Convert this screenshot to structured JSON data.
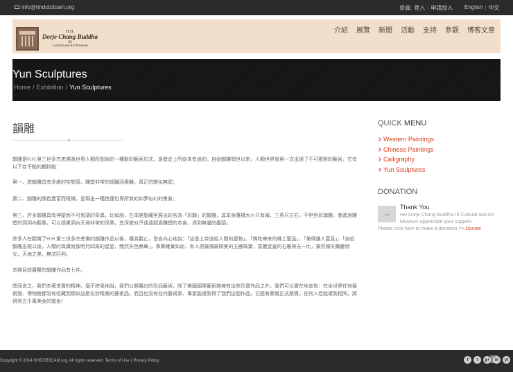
{
  "topbar": {
    "email": "info@hhdcb3cam.org",
    "member_label": "會員:",
    "login": "登入",
    "join": "申請加入",
    "lang_en": "English",
    "lang_zh": "中文"
  },
  "logo": {
    "line1": "H.H.",
    "line2": "Dorje Chang Buddha",
    "line3": "III",
    "line4": "Cultural and Art Museum"
  },
  "nav": {
    "items": [
      "介紹",
      "展覽",
      "新聞",
      "活動",
      "支持",
      "參觀",
      "博客文章"
    ]
  },
  "banner": {
    "title": "Yun Sculptures",
    "breadcrumb": [
      "Home",
      "Exhibition",
      "Yun Sculptures"
    ],
    "separator": "/"
  },
  "article": {
    "heading": "韻雕",
    "paragraphs": [
      "韻雕是H.H.第三世多杰羌佛為世界人類所創始的一種新的藝術形式，是歷史上所從未有過的。自從韻雕問世以來，人類世界就第一次出現了不可複製的藝術，它有以下若干點的獨特點：",
      "第一、造韻雕具有多維的空間感，雕塑非常的細膩而複雜，真正的變化無窮；",
      "第二、韻雕的顏色豐富而斑斕，呈現出一種造僅世界所無的如夢似幻的景象；",
      "第三、許多韻雕具有神聖而不可思議的奇異，比如說，在本館聖藏室展出的名為「彩韻」的韻雕，其本身雕構大小只有兩、三英尺左右，不但色彩瑰麗，會進過雕塑的洞洞內觀看，可以感覺洞內天地非常的深奧，其深度似乎遠遠超過雕塑的本身，達到無邊的盡頭。",
      "許多人在觀賞了H.H.第三世多杰羌佛的韻雕作品以後，嘆為觀止，發自內心地說：「這是上帝送給人間的寶物」、「佛陀帶來的佛土聖品」、「美得讓人窒息」、「自從韻雕出現以後，人類的珠寶就像明月四周的星星，黯然失色無華」，事實確實如此，有人把最傳最精美的玉器珠寶，富麗堂皇的石雕帶去一比，果然頓失豔麗特光，天地之差，無法匹判。",
      "本館目前展覽的韻雕作品有七件。",
      "總而言之，我們本著求實的精神，毫不誇張地說，我們公開展出的珍品藝術，除了美國國際藝術館擁有這些珍寶作品之外，我們可以實在地宣告：在全世界任何藝術館、博物館都沒有收藏到類似這麼玄妙精美的藝術品，而且也沒有任何藝術家、專家能複製得了我們這個作品，已經有懸賞正式懸賞，任何人若能複製相同，將得到五千萬美金的獎金！"
    ]
  },
  "sidebar": {
    "quick_prefix": "QUICK",
    "quick_suffix": "MENU",
    "menu": [
      "Western Paintings",
      "Chinese Paintings",
      "Calligraphy",
      "Yun Sculptures"
    ]
  },
  "donation": {
    "heading": "DONATION",
    "thumb_label": "img",
    "title": "Thank You",
    "description": "HH Dorje Chang Buddha III Cultural and Art Museum appreciate your support.",
    "prompt": "Please click here to make a donation >>",
    "link": "Donate"
  },
  "footer": {
    "copyright": "Copyright © 2014 HHDCB3CAM.org. All rights reserved.",
    "terms": "Terms of Use",
    "divider": "|",
    "privacy": "Privacy Policy",
    "social": [
      "f",
      "t",
      "g+",
      "in",
      "yt"
    ],
    "to_top": "⇑"
  },
  "colors": {
    "accent": "#d9411e",
    "header_bg": "#f2dfcb",
    "dark_bg": "#2b2b2b"
  }
}
